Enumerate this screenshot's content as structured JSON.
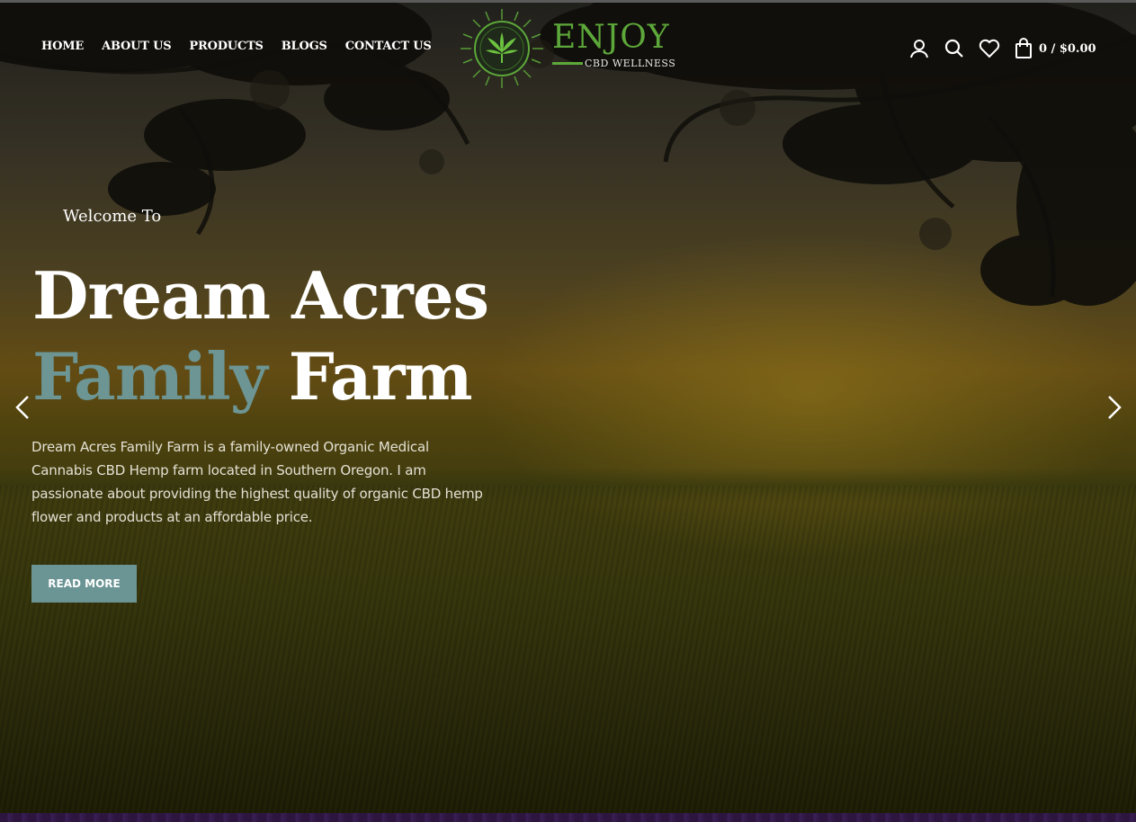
{
  "nav": {
    "items": [
      {
        "label": "HOME"
      },
      {
        "label": "ABOUT US"
      },
      {
        "label": "PRODUCTS"
      },
      {
        "label": "BLOGS"
      },
      {
        "label": "CONTACT US"
      }
    ]
  },
  "logo": {
    "word": "ENJOY",
    "subtitle": "CBD WELLNESS",
    "brand_color": "#5da83a"
  },
  "header": {
    "icons": [
      "user-icon",
      "search-icon",
      "heart-icon",
      "shopping-bag-icon"
    ],
    "cart_total": "0 / $0.00"
  },
  "hero": {
    "welcome": "Welcome To",
    "title_line1": "Dream Acres",
    "title_accent": "Family",
    "title_rest": "Farm",
    "accent_color": "#6c9593",
    "description": "Dream Acres Family Farm is a family-owned Organic Medical Cannabis CBD Hemp farm located in Southern Oregon. I am passionate about providing the highest quality of organic CBD hemp flower and products at an affordable price.",
    "button_label": "READ MORE",
    "button_color": "#6b9594"
  },
  "slider": {
    "prev_icon": "chevron-left-icon",
    "next_icon": "chevron-right-icon"
  }
}
